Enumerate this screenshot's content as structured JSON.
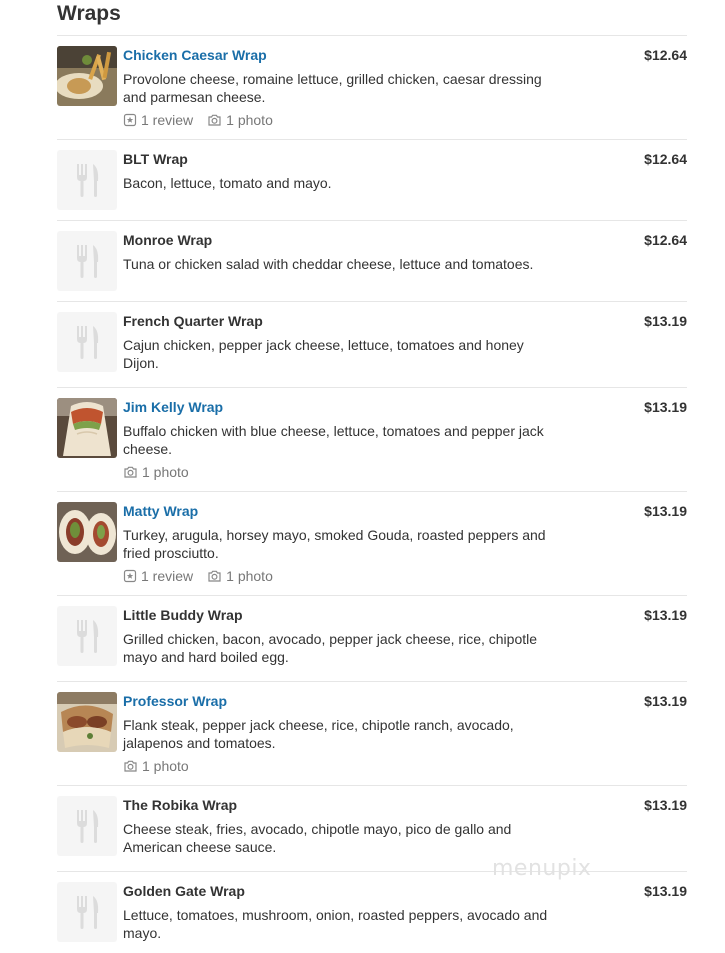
{
  "section": {
    "title": "Wraps"
  },
  "items": [
    {
      "name": "Chicken Caesar Wrap",
      "price": "$12.64",
      "description": "Provolone cheese, romaine lettuce, grilled chicken, caesar dressing and parmesan cheese.",
      "review_label": "1 review",
      "photo_label": "1 photo",
      "has_photo": true
    },
    {
      "name": "BLT Wrap",
      "price": "$12.64",
      "description": "Bacon, lettuce, tomato and mayo.",
      "has_photo": false
    },
    {
      "name": "Monroe Wrap",
      "price": "$12.64",
      "description": "Tuna or chicken salad with cheddar cheese, lettuce and tomatoes.",
      "has_photo": false
    },
    {
      "name": "French Quarter Wrap",
      "price": "$13.19",
      "description": "Cajun chicken, pepper jack cheese, lettuce, tomatoes and honey Dijon.",
      "has_photo": false
    },
    {
      "name": "Jim Kelly Wrap",
      "price": "$13.19",
      "description": "Buffalo chicken with blue cheese, lettuce, tomatoes and pepper jack cheese.",
      "photo_label": "1 photo",
      "has_photo": true
    },
    {
      "name": "Matty Wrap",
      "price": "$13.19",
      "description": "Turkey, arugula, horsey mayo, smoked Gouda, roasted peppers and fried prosciutto.",
      "review_label": "1 review",
      "photo_label": "1 photo",
      "has_photo": true
    },
    {
      "name": "Little Buddy Wrap",
      "price": "$13.19",
      "description": "Grilled chicken, bacon, avocado, pepper jack cheese, rice, chipotle mayo and hard boiled egg.",
      "has_photo": false
    },
    {
      "name": "Professor Wrap",
      "price": "$13.19",
      "description": "Flank steak, pepper jack cheese, rice, chipotle ranch, avocado, jalapenos and tomatoes.",
      "photo_label": "1 photo",
      "has_photo": true
    },
    {
      "name": "The Robika Wrap",
      "price": "$13.19",
      "description": "Cheese steak, fries, avocado, chipotle mayo, pico de gallo and American cheese sauce.",
      "has_photo": false
    },
    {
      "name": "Golden Gate Wrap",
      "price": "$13.19",
      "description": "Lettuce, tomatoes, mushroom, onion, roasted peppers, avocado and mayo.",
      "has_photo": false
    }
  ],
  "watermark": "menupix",
  "colors": {
    "link": "#1a6ea8",
    "text": "#333333",
    "muted": "#777777",
    "divider": "#e6e6e6",
    "placeholder_bg": "#f5f5f5"
  }
}
